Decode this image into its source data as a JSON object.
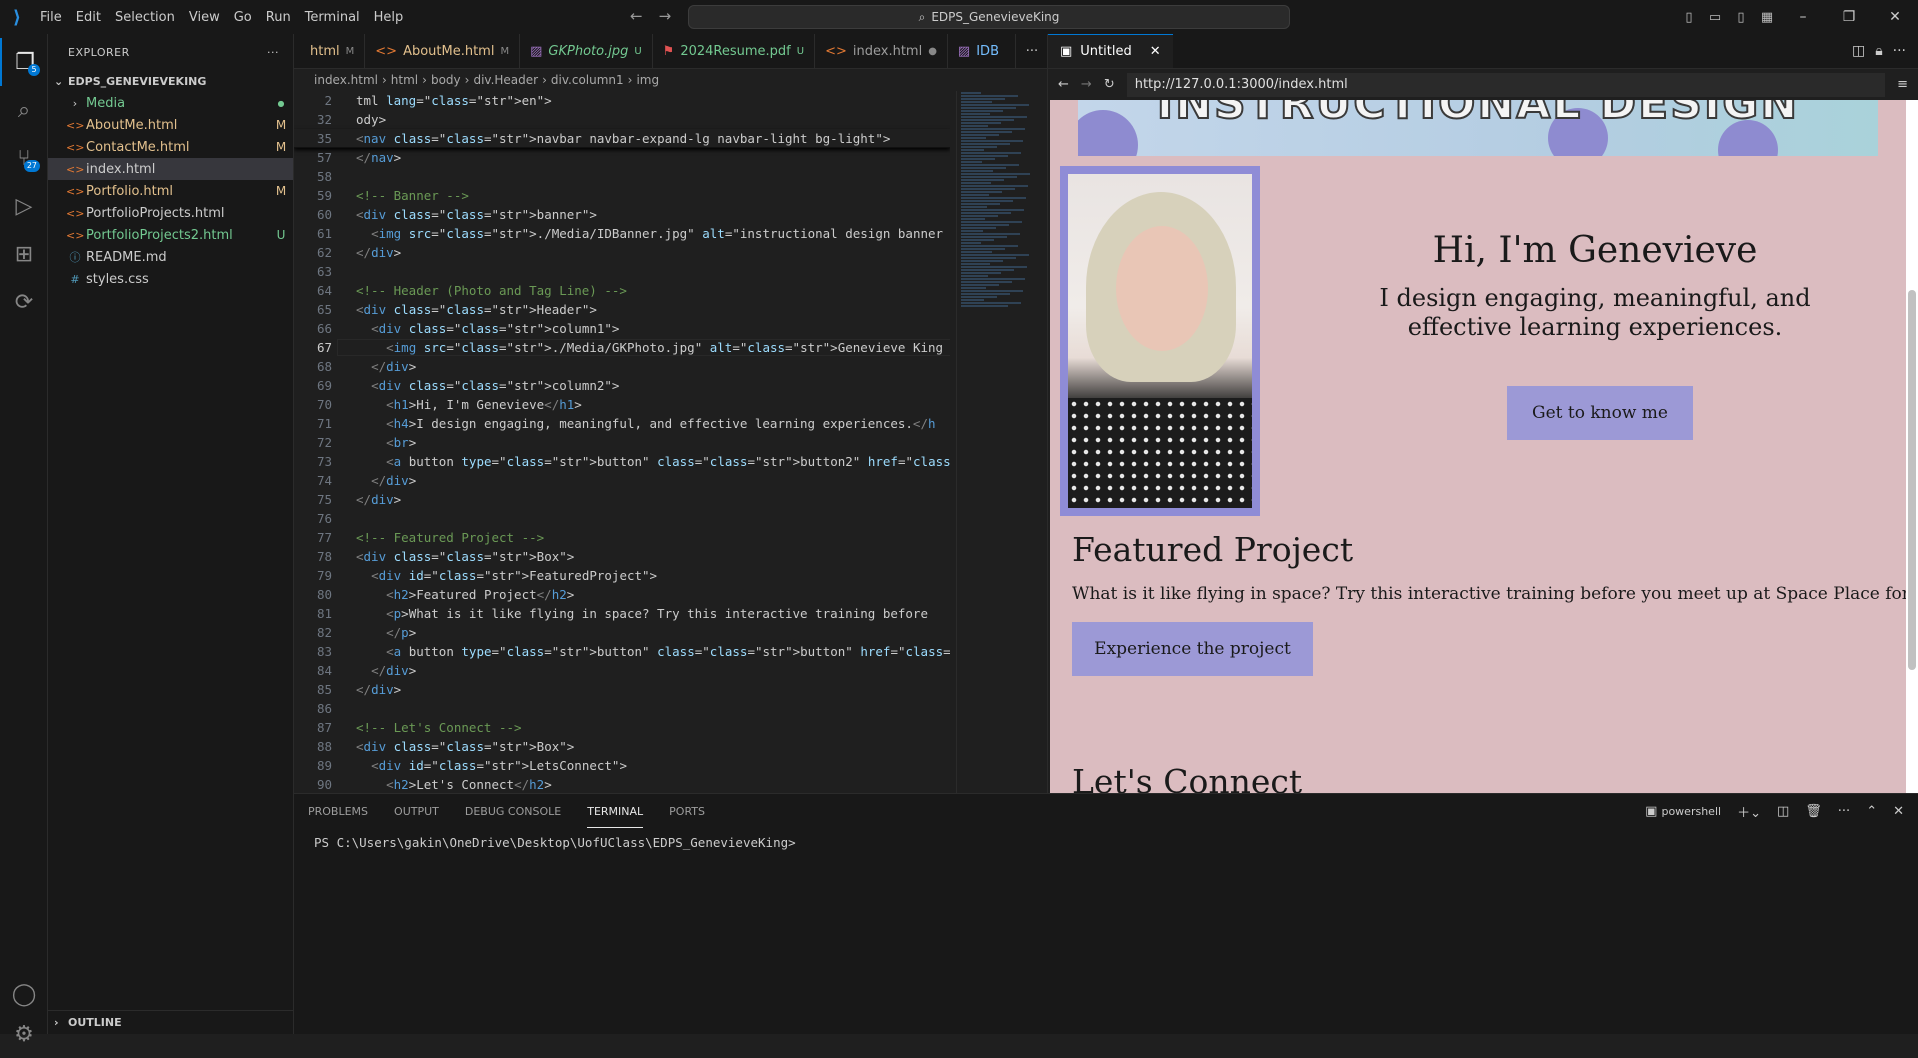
{
  "menu": [
    "File",
    "Edit",
    "Selection",
    "View",
    "Go",
    "Run",
    "Terminal",
    "Help"
  ],
  "command_center": "EDPS_GenevieveKing",
  "activity_badges": {
    "explorer": "5",
    "scm": "27"
  },
  "sidebar": {
    "title": "EXPLORER",
    "folder": "EDPS_GENEVIEVEKING",
    "items": [
      {
        "name": "Media",
        "status": "●",
        "kind": "folder"
      },
      {
        "name": "AboutMe.html",
        "status": "M",
        "kind": "modified"
      },
      {
        "name": "ContactMe.html",
        "status": "M",
        "kind": "modified"
      },
      {
        "name": "index.html",
        "status": "",
        "kind": "selected"
      },
      {
        "name": "Portfolio.html",
        "status": "M",
        "kind": "modified"
      },
      {
        "name": "PortfolioProjects.html",
        "status": "",
        "kind": "plain"
      },
      {
        "name": "PortfolioProjects2.html",
        "status": "U",
        "kind": "untracked"
      },
      {
        "name": "README.md",
        "status": "",
        "kind": "plain"
      },
      {
        "name": "styles.css",
        "status": "",
        "kind": "plain"
      }
    ],
    "outline": "OUTLINE"
  },
  "editor": {
    "tabs": [
      {
        "label": "html",
        "status": "M"
      },
      {
        "label": "AboutMe.html",
        "status": "M"
      },
      {
        "label": "GKPhoto.jpg",
        "status": "U"
      },
      {
        "label": "2024Resume.pdf",
        "status": "U"
      },
      {
        "label": "index.html",
        "status": "●"
      },
      {
        "label": "IDB",
        "status": ""
      }
    ],
    "breadcrumbs": [
      "index.html",
      "html",
      "body",
      "div.Header",
      "div.column1",
      "img"
    ],
    "sticky_lines": [
      {
        "n": "2",
        "t": "tml lang=\"en\">"
      },
      {
        "n": "32",
        "t": "ody>"
      },
      {
        "n": "35",
        "t": "<nav class=\"navbar navbar-expand-lg navbar-light bg-light\">"
      }
    ],
    "lines": [
      {
        "n": "57",
        "t": "</nav>"
      },
      {
        "n": "58",
        "t": ""
      },
      {
        "n": "59",
        "t": "<!-- Banner -->"
      },
      {
        "n": "60",
        "t": "<div class=\"banner\">"
      },
      {
        "n": "61",
        "t": "  <img src=\"./Media/IDBanner.jpg\" alt=\"instructional design banner made from"
      },
      {
        "n": "62",
        "t": "</div>"
      },
      {
        "n": "63",
        "t": ""
      },
      {
        "n": "64",
        "t": "<!-- Header (Photo and Tag Line) -->"
      },
      {
        "n": "65",
        "t": "<div class=\"Header\">"
      },
      {
        "n": "66",
        "t": "  <div class=\"column1\">"
      },
      {
        "n": "67",
        "t": "    <img src=\"./Media/GKPhoto.jpg\" alt=\"Genevieve King Photo\">"
      },
      {
        "n": "68",
        "t": "  </div>"
      },
      {
        "n": "69",
        "t": "  <div class=\"column2\">"
      },
      {
        "n": "70",
        "t": "    <h1>Hi, I'm Genevieve</h1>"
      },
      {
        "n": "71",
        "t": "    <h4>I design engaging, meaningful, and effective learning experiences.</h"
      },
      {
        "n": "72",
        "t": "    <br>"
      },
      {
        "n": "73",
        "t": "    <a button type=\"button\" class=\"button2\" href=\"./AboutMe.html\">Get to know"
      },
      {
        "n": "74",
        "t": "  </div>"
      },
      {
        "n": "75",
        "t": "</div>"
      },
      {
        "n": "76",
        "t": ""
      },
      {
        "n": "77",
        "t": "<!-- Featured Project -->"
      },
      {
        "n": "78",
        "t": "<div class=\"Box\">"
      },
      {
        "n": "79",
        "t": "  <div id=\"FeaturedProject\">"
      },
      {
        "n": "80",
        "t": "    <h2>Featured Project</h2>"
      },
      {
        "n": "81",
        "t": "    <p>What is it like flying in space? Try this interactive training before"
      },
      {
        "n": "82",
        "t": "    </p>"
      },
      {
        "n": "83",
        "t": "    <a button type=\"button\" class=\"button\" href=\"./Portfolio.html\">Experience"
      },
      {
        "n": "84",
        "t": "  </div>"
      },
      {
        "n": "85",
        "t": "</div>"
      },
      {
        "n": "86",
        "t": ""
      },
      {
        "n": "87",
        "t": "<!-- Let's Connect -->"
      },
      {
        "n": "88",
        "t": "<div class=\"Box\">"
      },
      {
        "n": "89",
        "t": "  <div id=\"LetsConnect\">"
      },
      {
        "n": "90",
        "t": "    <h2>Let's Connect</h2>"
      }
    ]
  },
  "browser": {
    "tab_label": "Untitled",
    "url": "http://127.0.0.1:3000/index.html",
    "page": {
      "banner_text": "INSTRUCTIONAL DESIGN",
      "h1": "Hi, I'm Genevieve",
      "h4": "I design engaging, meaningful, and effective learning experiences.",
      "about_button": "Get to know me",
      "featured_heading": "Featured Project",
      "featured_text": "What is it like flying in space? Try this interactive training before you meet up at Space Place for a ride!",
      "featured_button": "Experience the project",
      "connect_heading": "Let's Connect"
    }
  },
  "panel": {
    "tabs": [
      "PROBLEMS",
      "OUTPUT",
      "DEBUG CONSOLE",
      "TERMINAL",
      "PORTS"
    ],
    "active_tab": "TERMINAL",
    "shell": "powershell",
    "prompt": "PS C:\\Users\\gakin\\OneDrive\\Desktop\\UofUClass\\EDPS_GenevieveKing>"
  }
}
